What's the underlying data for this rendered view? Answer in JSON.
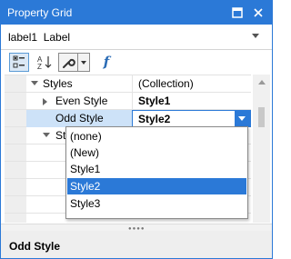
{
  "window": {
    "title": "Property Grid"
  },
  "selector": {
    "object_name": "label1",
    "object_type": "Label"
  },
  "grid": {
    "rows": [
      {
        "name": "Styles",
        "value": "(Collection)"
      },
      {
        "name": "Even Style",
        "value": "Style1"
      },
      {
        "name": "Odd Style",
        "value": "Style2"
      },
      {
        "name": "Sty",
        "value": ""
      }
    ]
  },
  "dropdown": {
    "options": [
      "(none)",
      "(New)",
      "Style1",
      "Style2",
      "Style3"
    ],
    "selected": "Style2"
  },
  "description": {
    "title": "Odd Style"
  },
  "colors": {
    "accent": "#2b79d7",
    "selection": "#cde2f8"
  }
}
